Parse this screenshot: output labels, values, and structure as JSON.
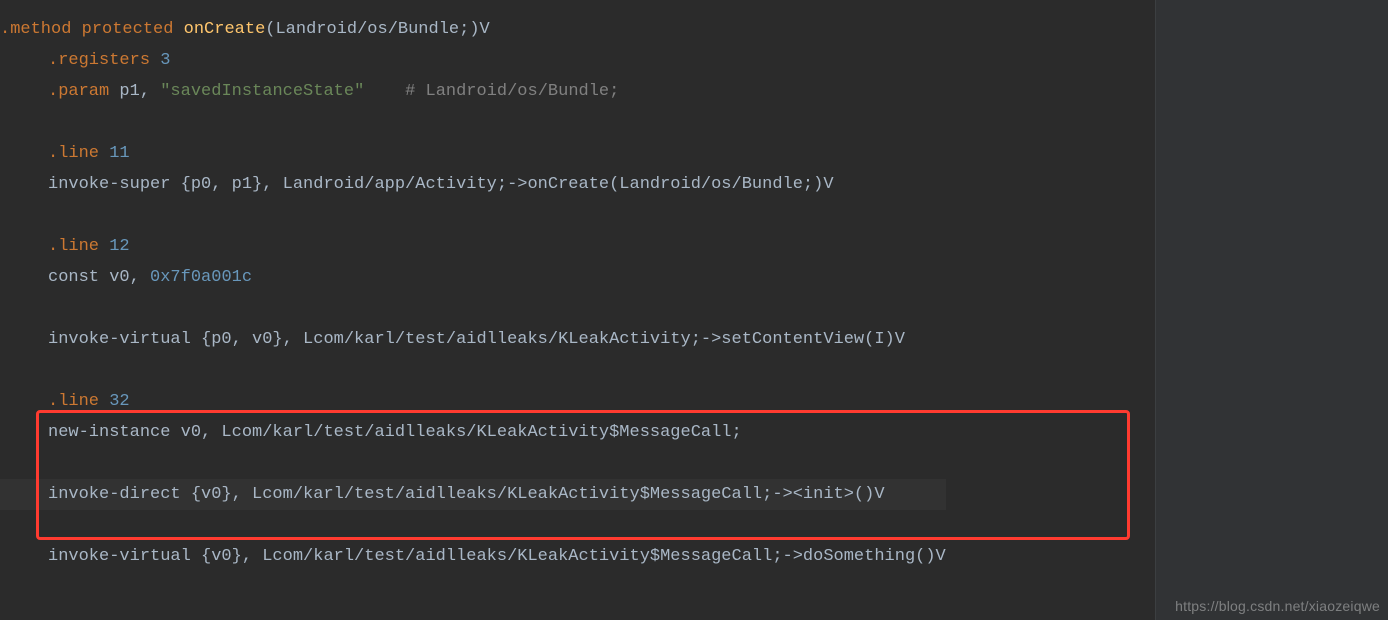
{
  "watermark": "https://blog.csdn.net/xiaozeiqwe",
  "code": {
    "l1": {
      "a": ".method",
      "b": " ",
      "c": "protected",
      "d": " ",
      "e": "onCreate",
      "f": "(Landroid/os/Bundle;)V"
    },
    "l2": {
      "a": ".registers ",
      "b": "3"
    },
    "l3": {
      "a": ".param ",
      "b": "p1,",
      "c": " ",
      "d": "\"savedInstanceState\"",
      "e": "    ",
      "f": "# Landroid/os/Bundle;"
    },
    "l5": {
      "a": ".line ",
      "b": "11"
    },
    "l6": "invoke-super {p0, p1}, Landroid/app/Activity;->onCreate(Landroid/os/Bundle;)V",
    "l8": {
      "a": ".line ",
      "b": "12"
    },
    "l9": {
      "a": "const v0, ",
      "b": "0x7f0a001c"
    },
    "l11": "invoke-virtual {p0, v0}, Lcom/karl/test/aidlleaks/KLeakActivity;->setContentView(I)V",
    "l13": {
      "a": ".line ",
      "b": "32"
    },
    "l14": "new-instance v0, Lcom/karl/test/aidlleaks/KLeakActivity$MessageCall;",
    "l16": "invoke-direct {v0}, Lcom/karl/test/aidlleaks/KLeakActivity$MessageCall;-><init>()V",
    "l18": "invoke-virtual {v0}, Lcom/karl/test/aidlleaks/KLeakActivity$MessageCall;->doSomething()V"
  }
}
